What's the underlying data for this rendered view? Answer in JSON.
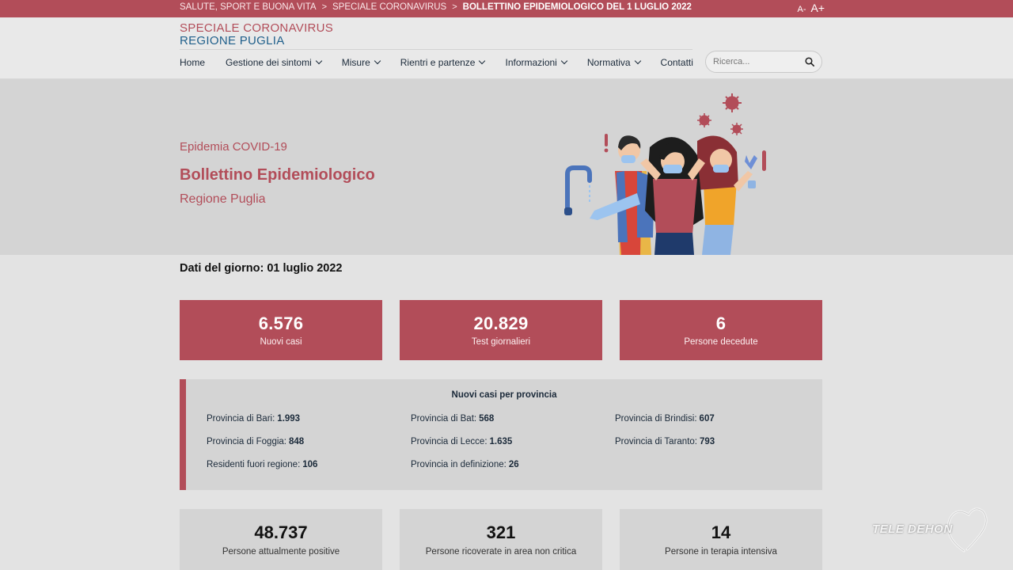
{
  "topbar": {
    "breadcrumbs": [
      "SALUTE, SPORT E BUONA VITA",
      "SPECIALE CORONAVIRUS",
      "BOLLETTINO EPIDEMIOLOGICO DEL 1 LUGLIO 2022"
    ],
    "separator": ">",
    "font_decrease": "A-",
    "font_increase": "A+"
  },
  "header": {
    "brand_line1": "SPECIALE CORONAVIRUS",
    "brand_line2": "REGIONE PUGLIA",
    "nav": [
      {
        "label": "Home",
        "dropdown": false
      },
      {
        "label": "Gestione dei sintomi",
        "dropdown": true
      },
      {
        "label": "Misure",
        "dropdown": true
      },
      {
        "label": "Rientri e partenze",
        "dropdown": true
      },
      {
        "label": "Informazioni",
        "dropdown": true
      },
      {
        "label": "Normativa",
        "dropdown": true
      },
      {
        "label": "Contatti",
        "dropdown": false
      }
    ],
    "search_placeholder": "Ricerca..."
  },
  "hero": {
    "eyebrow": "Epidemia COVID-19",
    "title": "Bollettino Epidemiologico",
    "subtitle": "Regione Puglia"
  },
  "date_line": "Dati del giorno: 01 luglio 2022",
  "stats": [
    {
      "value": "6.576",
      "label": "Nuovi casi"
    },
    {
      "value": "20.829",
      "label": "Test giornalieri"
    },
    {
      "value": "6",
      "label": "Persone decedute"
    }
  ],
  "provinces": {
    "title": "Nuovi casi per provincia",
    "rows": [
      [
        {
          "label": "Provincia di Bari:",
          "value": "1.993"
        },
        {
          "label": "Provincia di Bat:",
          "value": "568"
        },
        {
          "label": "Provincia di Brindisi:",
          "value": "607"
        }
      ],
      [
        {
          "label": "Provincia di Foggia:",
          "value": "848"
        },
        {
          "label": "Provincia di Lecce:",
          "value": "1.635"
        },
        {
          "label": "Provincia di Taranto:",
          "value": "793"
        }
      ],
      [
        {
          "label": "Residenti fuori regione:",
          "value": "106"
        },
        {
          "label": "Provincia in definizione:",
          "value": "26"
        }
      ]
    ]
  },
  "stats2": [
    {
      "value": "48.737",
      "label": "Persone attualmente positive"
    },
    {
      "value": "321",
      "label": "Persone ricoverate in area non critica"
    },
    {
      "value": "14",
      "label": "Persone in terapia intensiva"
    }
  ],
  "watermark": "TELE DEHON",
  "colors": {
    "accent": "#b24d59",
    "brand_blue": "#1f5f8b",
    "panel_grey": "#d4d4d4",
    "page_bg": "#e3e3e3"
  }
}
